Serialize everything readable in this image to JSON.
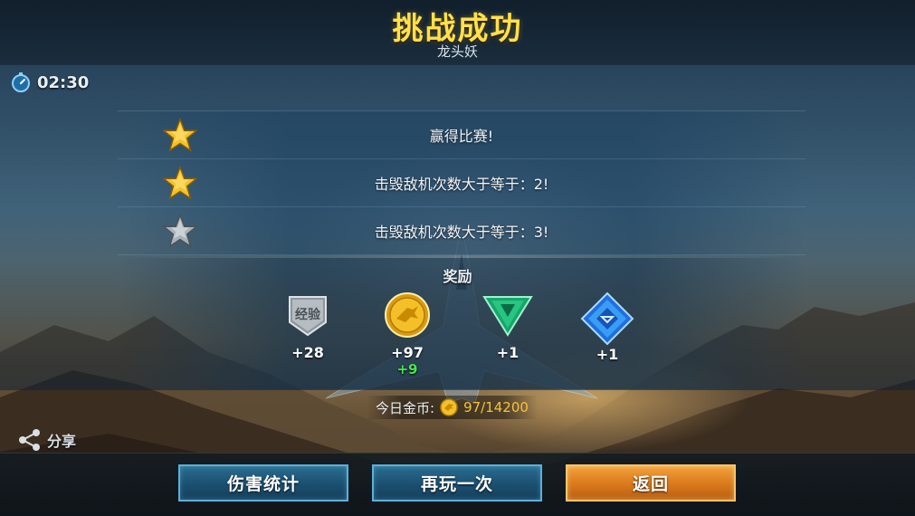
{
  "header": {
    "title": "挑战成功",
    "subtitle": "龙头妖"
  },
  "timer": {
    "icon": "stopwatch-icon",
    "text": "02:30"
  },
  "objectives": [
    {
      "label": "赢得比赛!",
      "star": "gold",
      "achieved": true
    },
    {
      "label": "击毁敌机次数大于等于：2!",
      "star": "gold",
      "achieved": true
    },
    {
      "label": "击毁敌机次数大于等于：3!",
      "star": "silver",
      "achieved": false
    }
  ],
  "rewards": {
    "title": "奖励",
    "items": [
      {
        "icon": "experience-badge-icon",
        "badge_text": "经验",
        "value": "+28",
        "bonus": ""
      },
      {
        "icon": "gold-coin-icon",
        "value": "+97",
        "bonus": "+9"
      },
      {
        "icon": "green-gem-icon",
        "value": "+1",
        "bonus": ""
      },
      {
        "icon": "blue-crystal-icon",
        "value": "+1",
        "bonus": ""
      }
    ]
  },
  "daily_gold": {
    "label": "今日金币:",
    "value": "97/14200"
  },
  "share": {
    "icon": "share-icon",
    "label": "分享"
  },
  "buttons": {
    "damage_stats": "伤害统计",
    "play_again": "再玩一次",
    "back": "返回"
  },
  "colors": {
    "title": "#ffe14a",
    "bonus": "#43e84a",
    "gold_text": "#f5c23b",
    "button_blue": "#1b4f70",
    "button_orange": "#d9781c"
  }
}
